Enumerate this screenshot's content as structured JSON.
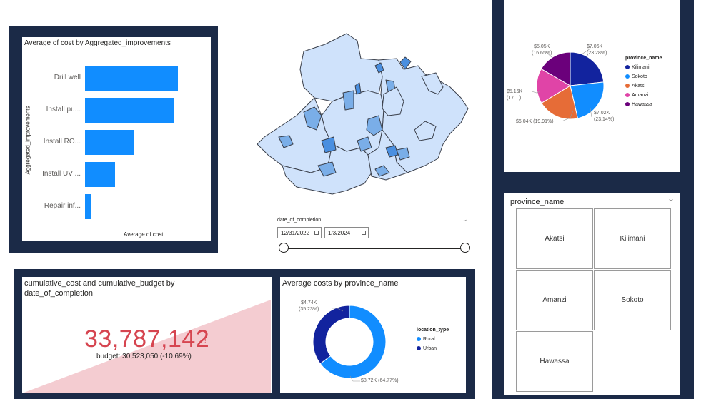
{
  "bar_chart": {
    "title": "Average of cost by Aggregated_improvements",
    "ylabel": "Aggregated_improvements",
    "xlabel": "Average of cost",
    "categories": [
      "Drill well",
      "Install pu...",
      "Install RO...",
      "Install UV ...",
      "Repair inf..."
    ]
  },
  "map": {},
  "date_slicer": {
    "label": "date_of_completion",
    "start": "12/31/2022",
    "end": "1/3/2024"
  },
  "pie_chart": {
    "legend_title": "province_name",
    "legend": [
      "Kilimani",
      "Sokoto",
      "Akatsi",
      "Amanzi",
      "Hawassa"
    ],
    "labels": {
      "kilimani": "$7.06K",
      "kilimani_pct": "(23.28%)",
      "sokoto": "$7.02K",
      "sokoto_pct": "(23.14%)",
      "akatsi": "$6.04K (19.91%)",
      "amanzi": "$5.16K",
      "amanzi_pct": "(17....)",
      "hawassa": "$5.05K",
      "hawassa_pct": "(16.65%)"
    }
  },
  "province_slicer": {
    "title": "province_name",
    "items": [
      "Akatsi",
      "Kilimani",
      "Amanzi",
      "Sokoto",
      "Hawassa"
    ]
  },
  "kpi": {
    "title_line1": "cumulative_cost and cumulative_budget by",
    "title_line2": "date_of_completion",
    "value": "33,787,142",
    "indicator": "!",
    "budget": "budget: 30,523,050 (-10.69%)"
  },
  "donut": {
    "title": "Average costs by province_name",
    "legend_title": "location_type",
    "legend": [
      "Rural",
      "Urban"
    ],
    "label_urban": "$4.74K",
    "label_urban_pct": "(35.23%)",
    "label_rural": "$8.72K (64.77%)"
  },
  "colors": {
    "navy": "#1b2a47",
    "bar": "#118dff",
    "kilimani": "#12239e",
    "sokoto": "#118dff",
    "akatsi": "#e66c37",
    "amanzi": "#e044a7",
    "hawassa": "#6b007b",
    "kpi_red": "#d64550"
  },
  "chart_data": [
    {
      "type": "bar",
      "title": "Average of cost by Aggregated_improvements",
      "categories": [
        "Drill well",
        "Install pu...",
        "Install RO...",
        "Install UV ...",
        "Repair inf..."
      ],
      "values": [
        8.6,
        8.2,
        4.5,
        2.8,
        0.6
      ],
      "xlabel": "Average of cost",
      "ylabel": "Aggregated_improvements"
    },
    {
      "type": "pie",
      "categories": [
        "Kilimani",
        "Sokoto",
        "Akatsi",
        "Amanzi",
        "Hawassa"
      ],
      "values": [
        7.06,
        7.02,
        6.04,
        5.16,
        5.05
      ],
      "percents": [
        23.28,
        23.14,
        19.91,
        17.0,
        16.65
      ]
    },
    {
      "type": "pie",
      "title": "Average costs by province_name",
      "categories": [
        "Rural",
        "Urban"
      ],
      "values": [
        8.72,
        4.74
      ],
      "percents": [
        64.77,
        35.23
      ]
    }
  ]
}
